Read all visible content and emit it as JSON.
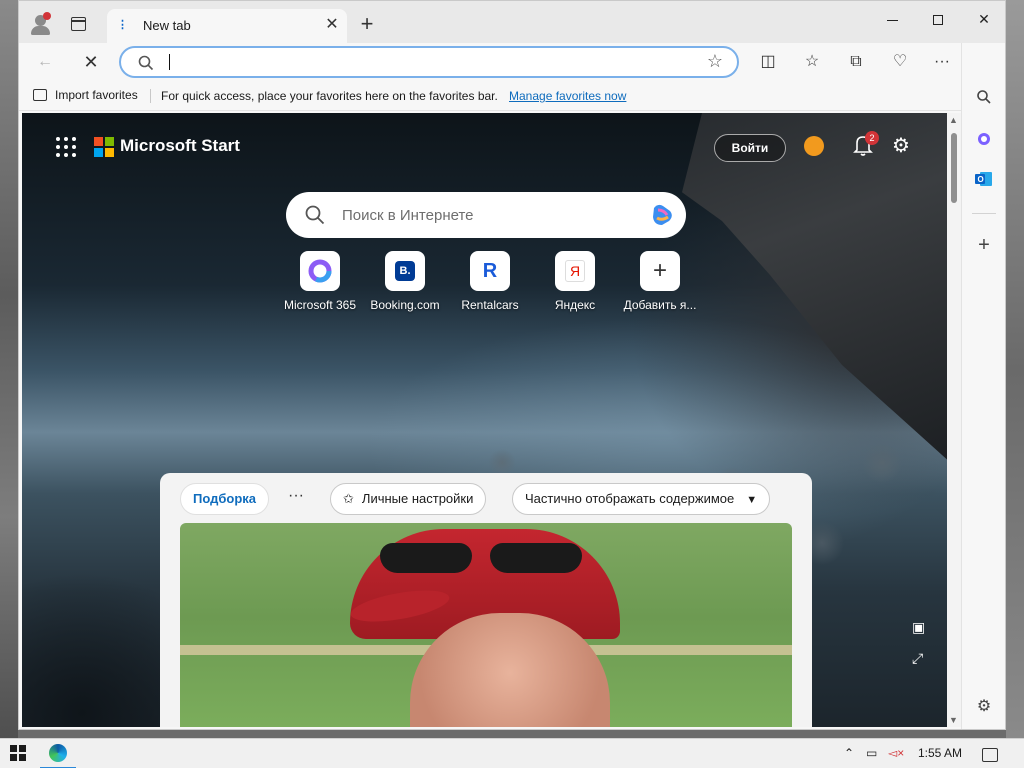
{
  "tab": {
    "title": "New tab",
    "close": "✕"
  },
  "window": {
    "minimize": "Minimize",
    "maximize": "Maximize",
    "close": "✕"
  },
  "toolbar": {
    "back": "←",
    "stop": "✕",
    "address_value": "",
    "favorite_star": "☆",
    "right_icons": [
      "split-screen-icon",
      "favorites-icon",
      "collections-icon",
      "browser-essentials-icon",
      "more-icon",
      "copilot-icon"
    ]
  },
  "favbar": {
    "import": "Import favorites",
    "message": "For quick access, place your favorites here on the favorites bar.",
    "manage_link": "Manage favorites now"
  },
  "sidebar": {
    "icons": [
      "search-icon",
      "copilot-sidebar-icon",
      "outlook-icon",
      "add-icon",
      "settings-icon"
    ]
  },
  "page": {
    "brand": "Microsoft Start",
    "signin": "Войти",
    "notifications_count": "2",
    "search_placeholder": "Поиск в Интернете",
    "quick_links": [
      {
        "label": "Microsoft 365"
      },
      {
        "label": "Booking.com",
        "glyph": "B."
      },
      {
        "label": "Rentalcars",
        "glyph": "R"
      },
      {
        "label": "Яндекс",
        "glyph": "Я"
      },
      {
        "label": "Добавить я...",
        "glyph": "+"
      }
    ]
  },
  "feed": {
    "tab_active": "Подборка",
    "more": "···",
    "personalize": "Личные настройки",
    "display_mode": "Частично отображать содержимое"
  },
  "colors": {
    "accent": "#0f6cbd",
    "badge": "#d13438",
    "rewards": "#f29a1e"
  },
  "taskbar": {
    "time": "1:55 AM"
  }
}
